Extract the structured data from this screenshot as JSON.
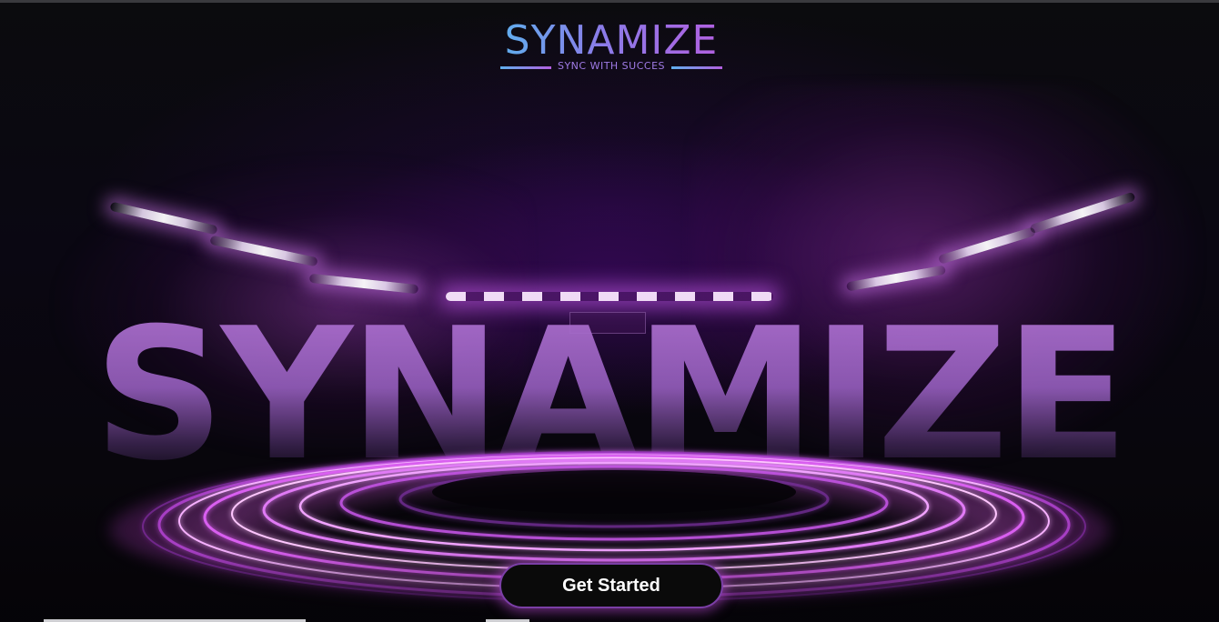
{
  "brand": {
    "logo_text": "SYNAMIZE",
    "tagline": "SYNC WITH SUCCES",
    "gradient_start": "#5fb0ee",
    "gradient_end": "#b35fe0"
  },
  "hero": {
    "background_word": "SYNAMIZE",
    "accent_color": "#c44fe0"
  },
  "cta": {
    "label": "Get Started"
  }
}
